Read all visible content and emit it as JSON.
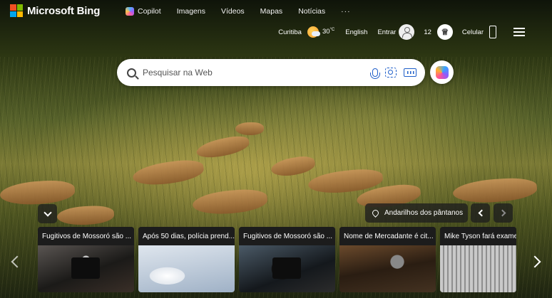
{
  "header": {
    "brand": "Microsoft Bing",
    "logo_colors": [
      "#f25022",
      "#7fba00",
      "#00a4ef",
      "#ffb900"
    ],
    "nav": [
      {
        "label": "Copilot",
        "icon": "copilot-icon"
      },
      {
        "label": "Imagens"
      },
      {
        "label": "Vídeos"
      },
      {
        "label": "Mapas"
      },
      {
        "label": "Notícias"
      },
      {
        "label": "···"
      }
    ],
    "location": "Curitiba",
    "temperature": "30",
    "temp_unit": "°C",
    "language": "English",
    "sign_in": "Entrar",
    "rewards_count": "12",
    "phone_label": "Celular"
  },
  "search": {
    "placeholder": "Pesquisar na Web"
  },
  "hero": {
    "location_title": "Andarilhos dos pântanos"
  },
  "news": [
    {
      "title": "Fugitivos de Mossoró são ..."
    },
    {
      "title": "Após 50 dias, polícia prend..."
    },
    {
      "title": "Fugitivos de Mossoró são ..."
    },
    {
      "title": "Nome de Mercadante é cit..."
    },
    {
      "title": "Mike Tyson fará exames"
    }
  ],
  "colors": {
    "accent": "#1f5fc9"
  }
}
